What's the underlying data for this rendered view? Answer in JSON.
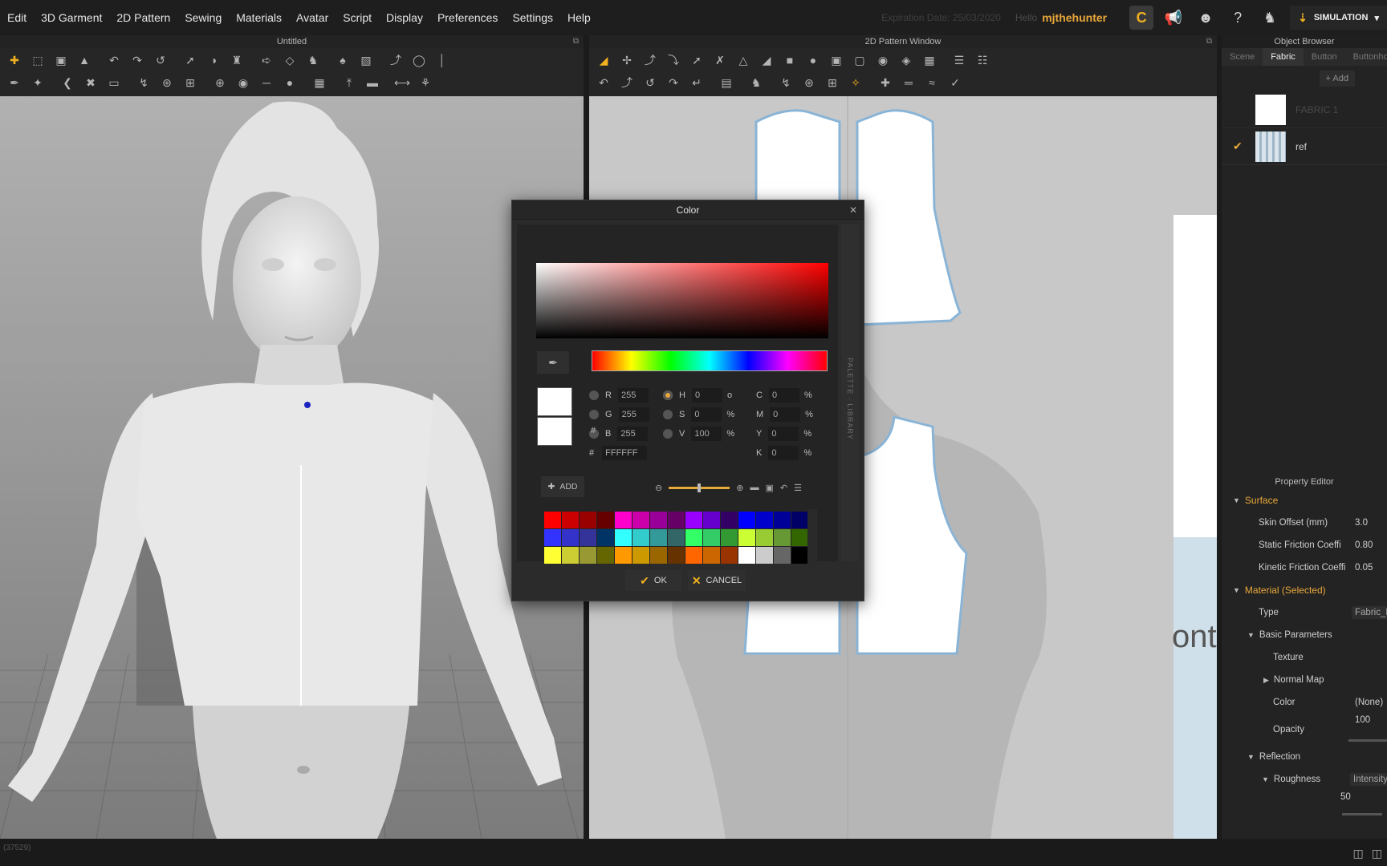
{
  "menu": {
    "items": [
      "Edit",
      "3D Garment",
      "2D Pattern",
      "Sewing",
      "Materials",
      "Avatar",
      "Script",
      "Display",
      "Preferences",
      "Settings",
      "Help"
    ],
    "expiration": "Expiration Date: 25/03/2020",
    "hello": "Hello",
    "username": "mjthehunter",
    "simulation_label": "SIMULATION"
  },
  "panels": {
    "view3d_title": "Untitled",
    "view2d_title": "2D Pattern Window",
    "object_browser_title": "Object Browser",
    "property_editor_title": "Property Editor"
  },
  "object_browser": {
    "tabs": [
      "Scene",
      "Fabric",
      "Button",
      "Buttonhole"
    ],
    "active_tab": "Fabric",
    "add_label": "+ Add",
    "fabrics": [
      {
        "name": "FABRIC 1",
        "checked": false
      },
      {
        "name": "ref",
        "checked": true
      }
    ]
  },
  "property_editor": {
    "surface_label": "Surface",
    "skin_offset_label": "Skin Offset (mm)",
    "skin_offset_value": "3.0",
    "static_friction_label": "Static Friction Coeffi",
    "static_friction_value": "0.80",
    "kinetic_friction_label": "Kinetic Friction Coeffi",
    "kinetic_friction_value": "0.05",
    "material_label": "Material (Selected)",
    "type_label": "Type",
    "type_value": "Fabric_M",
    "basic_params_label": "Basic Parameters",
    "texture_label": "Texture",
    "normal_map_label": "Normal Map",
    "color_label": "Color",
    "color_value": "(None)",
    "opacity_label": "Opacity",
    "opacity_value": "100",
    "reflection_label": "Reflection",
    "roughness_label": "Roughness",
    "roughness_mode": "Intensity",
    "roughness_value": "50"
  },
  "pattern_window": {
    "ref_text": "ont"
  },
  "status": {
    "text": "(37529)"
  },
  "color_dialog": {
    "title": "Color",
    "rgb": {
      "R": "255",
      "G": "255",
      "B": "255"
    },
    "hsv": {
      "H": "0",
      "S": "0",
      "V": "100"
    },
    "cmyk": {
      "C": "0",
      "M": "0",
      "Y": "0",
      "K": "0"
    },
    "hex_symbol": "#",
    "hex": "FFFFFF",
    "units": {
      "degree": "o",
      "percent": "%"
    },
    "add_label": "ADD",
    "ok_label": "OK",
    "cancel_label": "CANCEL",
    "sidebar_label": "PALETTE · LIBRARY",
    "selected_color": "#FFFFFF",
    "zoom_level": 0.5,
    "palette": [
      "#ff0000",
      "#cc0000",
      "#990000",
      "#660000",
      "#ff00cc",
      "#cc00aa",
      "#990099",
      "#660066",
      "#9900ff",
      "#6600cc",
      "#330066",
      "#0000ff",
      "#0000cc",
      "#000099",
      "#000066",
      "#3333ff",
      "#3333cc",
      "#333399",
      "#003366",
      "#33ffff",
      "#33cccc",
      "#339999",
      "#336666",
      "#33ff66",
      "#33cc66",
      "#339933",
      "#ccff33",
      "#99cc33",
      "#669933",
      "#336600",
      "#ffff33",
      "#cccc33",
      "#999933",
      "#666600",
      "#ff9900",
      "#cc9900",
      "#996600",
      "#663300",
      "#ff6600",
      "#cc6600",
      "#993300",
      "#ffffff",
      "#cccccc",
      "#666666",
      "#000000"
    ]
  }
}
